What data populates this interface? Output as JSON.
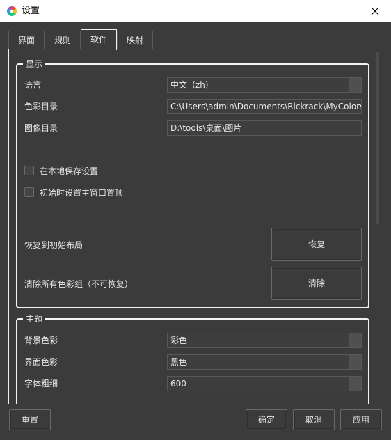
{
  "window": {
    "title": "设置",
    "icon": "color-wheel-icon",
    "close_icon": "close-icon"
  },
  "tabs": [
    {
      "label": "界面",
      "active": false
    },
    {
      "label": "规则",
      "active": false
    },
    {
      "label": "软件",
      "active": true
    },
    {
      "label": "映射",
      "active": false
    }
  ],
  "display": {
    "title": "显示",
    "language_label": "语言",
    "language_value": "中文（zh）",
    "color_dir_label": "色彩目录",
    "color_dir_value": "C:\\Users\\admin\\Documents\\Rickrack\\MyColors",
    "image_dir_label": "图像目录",
    "image_dir_value": "D:\\tools\\桌面\\图片",
    "save_local_label": "在本地保存设置",
    "save_local_checked": false,
    "topmost_label": "初始时设置主窗口置顶",
    "topmost_checked": false,
    "reset_layout_label": "恢复到初始布局",
    "reset_layout_button": "恢复",
    "clear_groups_label": "清除所有色彩组（不可恢复）",
    "clear_groups_button": "清除"
  },
  "theme": {
    "title": "主题",
    "bg_color_label": "背景色彩",
    "bg_color_value": "彩色",
    "ui_color_label": "界面色彩",
    "ui_color_value": "黑色",
    "font_weight_label": "字体粗细",
    "font_weight_value": "600"
  },
  "footer": {
    "reset_button": "重置",
    "ok_button": "确定",
    "cancel_button": "取消",
    "apply_button": "应用"
  },
  "colors": {
    "background": "#3b3b3b",
    "border_light": "#f2f2f2",
    "titlebar": "#ffffff"
  }
}
